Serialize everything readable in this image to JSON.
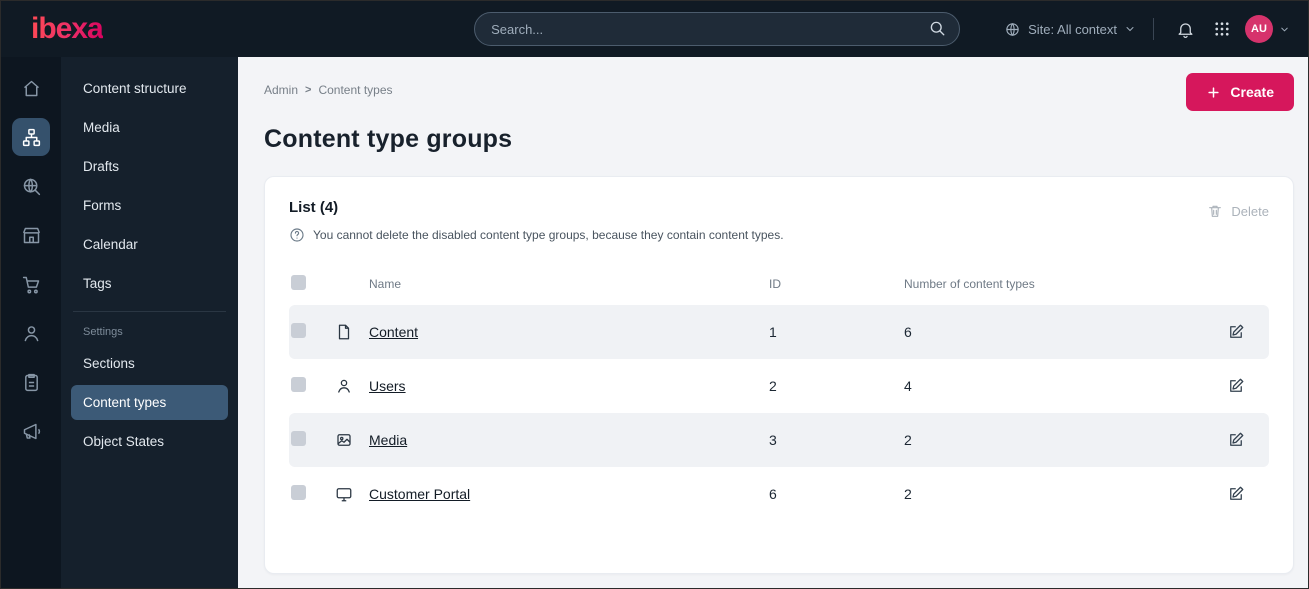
{
  "topbar": {
    "logo_text": "ibexa",
    "search_placeholder": "Search...",
    "site_context_label": "Site: All context",
    "avatar_initials": "AU"
  },
  "sidebar": {
    "rail": [
      {
        "icon": "home-icon"
      },
      {
        "icon": "content-tree-icon",
        "active": true
      },
      {
        "icon": "search-globe-icon"
      },
      {
        "icon": "storefront-icon"
      },
      {
        "icon": "cart-icon"
      },
      {
        "icon": "personalization-icon"
      },
      {
        "icon": "admin-list-icon"
      },
      {
        "icon": "megaphone-icon"
      }
    ],
    "menu": [
      {
        "label": "Content structure"
      },
      {
        "label": "Media"
      },
      {
        "label": "Drafts"
      },
      {
        "label": "Forms"
      },
      {
        "label": "Calendar"
      },
      {
        "label": "Tags"
      }
    ],
    "section_label": "Settings",
    "settings_menu": [
      {
        "label": "Sections"
      },
      {
        "label": "Content types",
        "active": true
      },
      {
        "label": "Object States"
      }
    ]
  },
  "main": {
    "breadcrumb": {
      "root": "Admin",
      "separator": ">",
      "current": "Content types"
    },
    "create_button": "Create",
    "page_title": "Content type groups",
    "list": {
      "title": "List (4)",
      "help_text": "You cannot delete the disabled content type groups, because they contain content types.",
      "delete_button": "Delete",
      "columns": {
        "name": "Name",
        "id": "ID",
        "count": "Number of content types"
      },
      "rows": [
        {
          "icon": "file-icon",
          "name": "Content",
          "id": "1",
          "count": "6"
        },
        {
          "icon": "user-icon",
          "name": "Users",
          "id": "2",
          "count": "4"
        },
        {
          "icon": "image-icon",
          "name": "Media",
          "id": "3",
          "count": "2"
        },
        {
          "icon": "monitor-icon",
          "name": "Customer Portal",
          "id": "6",
          "count": "2"
        }
      ]
    }
  },
  "colors": {
    "accent": "#d6175c",
    "dark_bg": "#101a24",
    "active_item": "#3c5a77"
  }
}
